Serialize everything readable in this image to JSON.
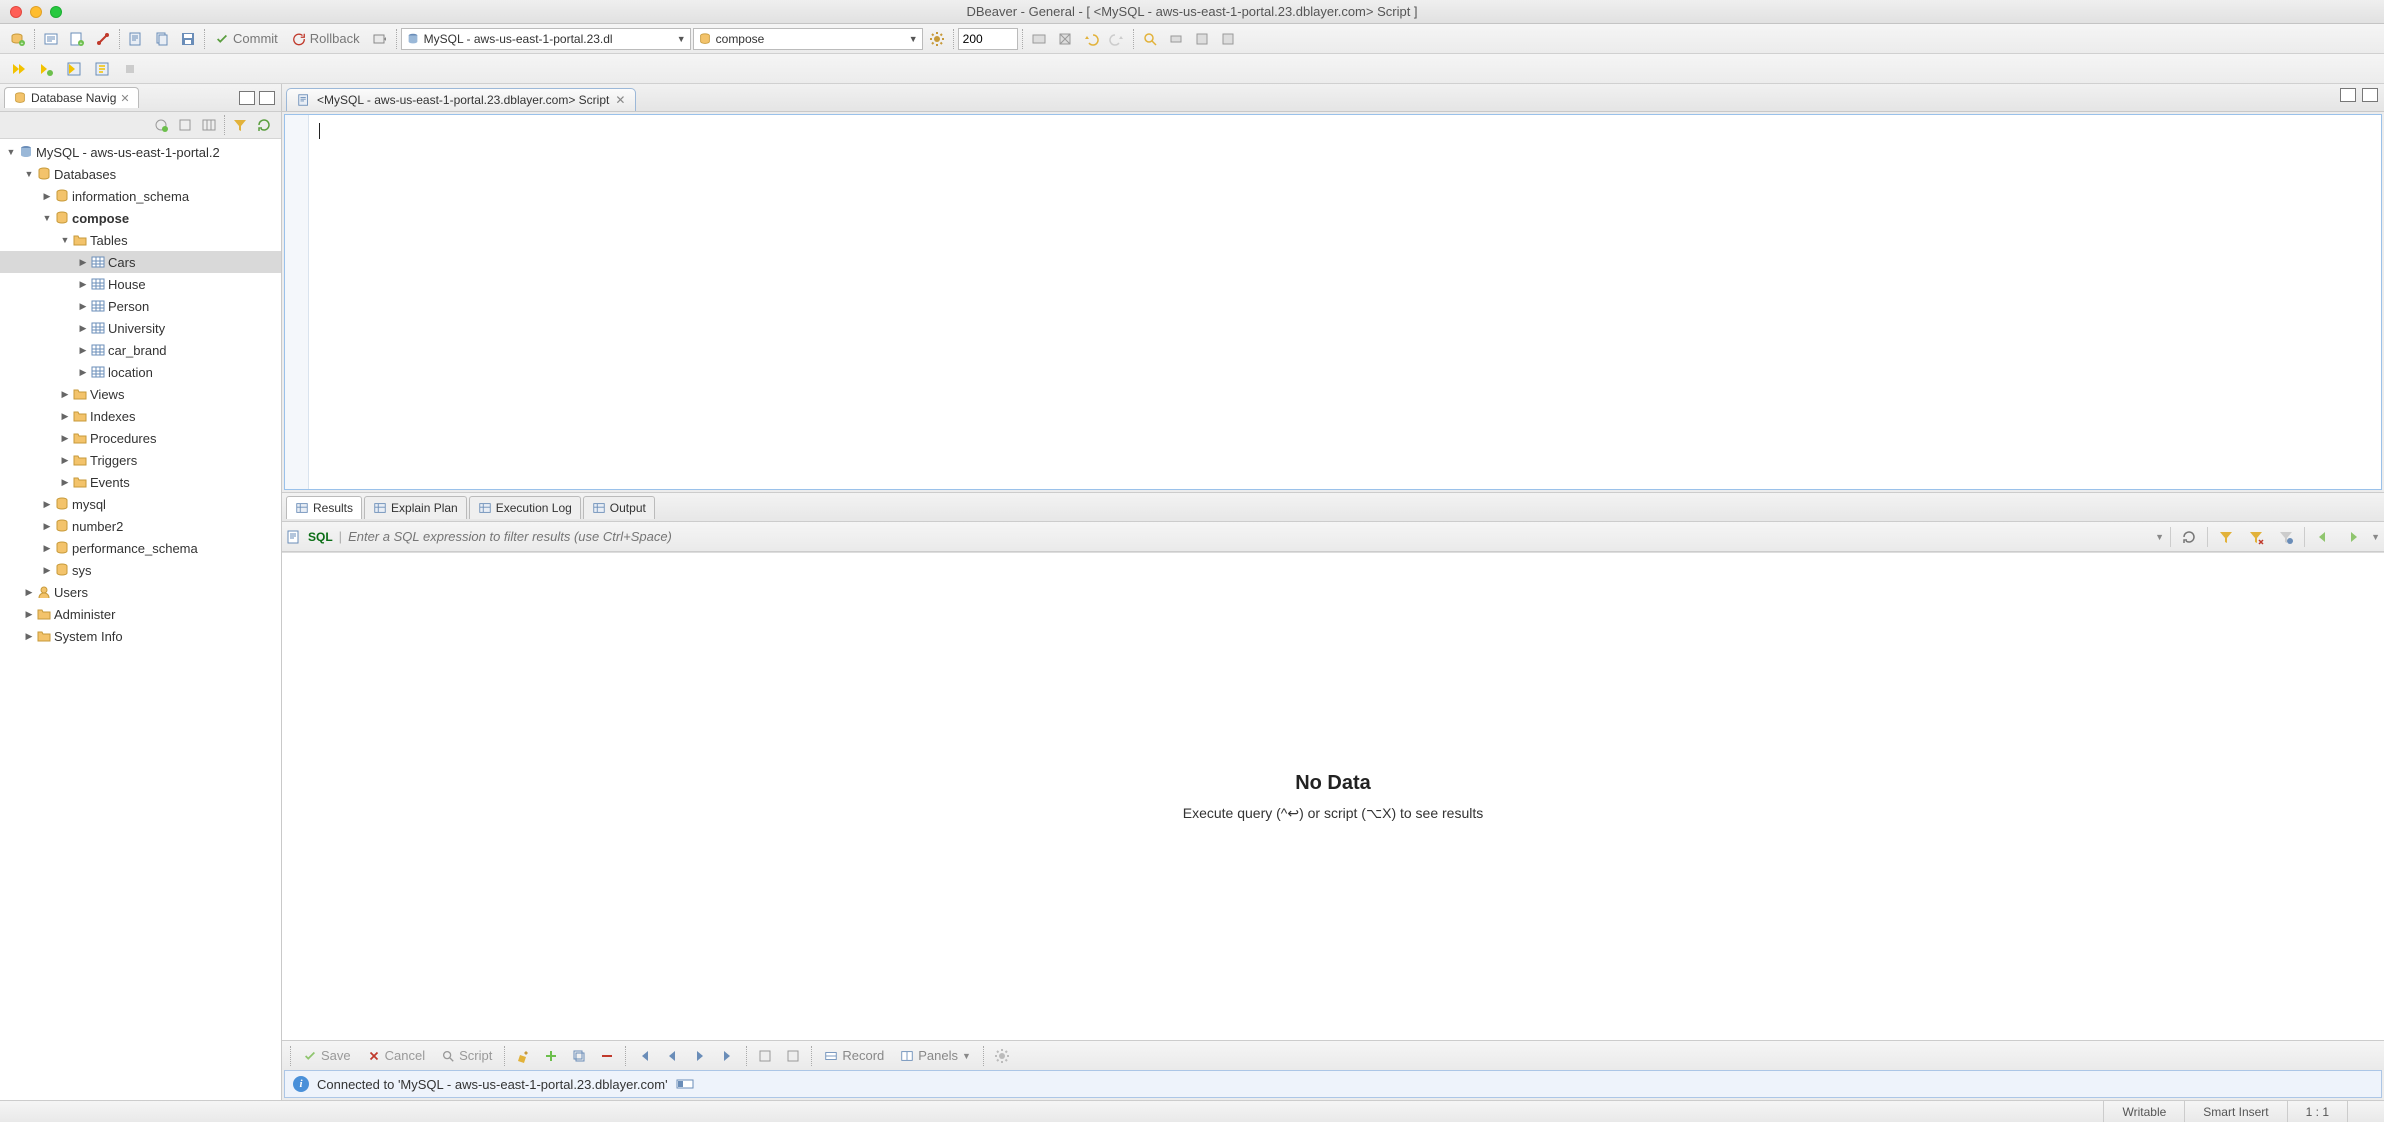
{
  "window": {
    "title": "DBeaver - General - [ <MySQL - aws-us-east-1-portal.23.dblayer.com> Script ]"
  },
  "toolbar": {
    "commit": "Commit",
    "rollback": "Rollback",
    "connection_combo": "MySQL - aws-us-east-1-portal.23.dl",
    "database_combo": "compose",
    "limit": "200"
  },
  "sidebar": {
    "tab": "Database Navig",
    "connection": "MySQL - aws-us-east-1-portal.2",
    "databases_label": "Databases",
    "databases": [
      {
        "name": "information_schema",
        "expanded": false,
        "bold": false
      },
      {
        "name": "compose",
        "expanded": true,
        "bold": true,
        "tables_label": "Tables",
        "tables": [
          "Cars",
          "House",
          "Person",
          "University",
          "car_brand",
          "location"
        ],
        "folders": [
          "Views",
          "Indexes",
          "Procedures",
          "Triggers",
          "Events"
        ]
      },
      {
        "name": "mysql",
        "expanded": false,
        "bold": false
      },
      {
        "name": "number2",
        "expanded": false,
        "bold": false
      },
      {
        "name": "performance_schema",
        "expanded": false,
        "bold": false
      },
      {
        "name": "sys",
        "expanded": false,
        "bold": false
      }
    ],
    "root_folders": [
      "Users",
      "Administer",
      "System Info"
    ]
  },
  "editor": {
    "tab": "<MySQL - aws-us-east-1-portal.23.dblayer.com> Script"
  },
  "result_tabs": [
    "Results",
    "Explain Plan",
    "Execution Log",
    "Output"
  ],
  "filter": {
    "sql_label": "SQL",
    "placeholder": "Enter a SQL expression to filter results (use Ctrl+Space)"
  },
  "results": {
    "heading": "No Data",
    "hint": "Execute query (^↩) or script (⌥X) to see results"
  },
  "results_toolbar": {
    "save": "Save",
    "cancel": "Cancel",
    "script": "Script",
    "record": "Record",
    "panels": "Panels"
  },
  "status": {
    "connection": "Connected to 'MySQL - aws-us-east-1-portal.23.dblayer.com'",
    "writable": "Writable",
    "insert_mode": "Smart Insert",
    "cursor": "1 : 1"
  }
}
